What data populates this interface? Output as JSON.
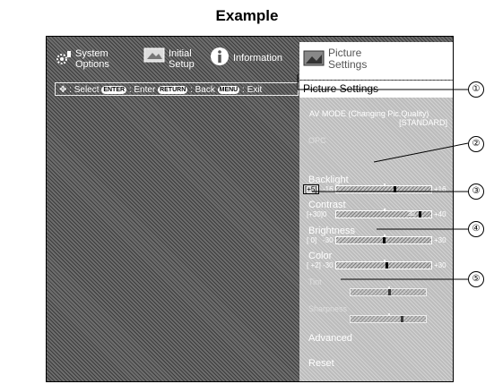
{
  "example_title": "Example",
  "top_menu": {
    "system_options": "System Options",
    "initial_setup": "Initial Setup",
    "information": "Information",
    "picture_settings": "Picture Settings",
    "menu": "Menu"
  },
  "guide": {
    "select": ": Select",
    "enter_key": "ENTER",
    "enter": ": Enter",
    "return_key": "RETURN",
    "back": ": Back",
    "menu_key": "MENU",
    "exit": ": Exit"
  },
  "panel": {
    "title": "Picture Settings",
    "av_mode_label": "AV MODE (Changing Pic.Quality)",
    "av_mode_value": "[STANDARD]",
    "opc": "OPC",
    "backlight": {
      "label": "Backlight",
      "value": "[+5]",
      "min": "-16",
      "max": "+16"
    },
    "contrast": {
      "label": "Contrast",
      "value": "[+30]",
      "min": "0",
      "max": "+40",
      "bar_num": "30"
    },
    "brightness": {
      "label": "Brightness",
      "value": "[ 0]",
      "min": "-30",
      "max": "+30"
    },
    "color": {
      "label": "Color",
      "value": "[ +2]",
      "min": "-30",
      "max": "+30"
    },
    "tint": "Tint",
    "sharpness": "Sharpness",
    "advanced": "Advanced",
    "reset": "Reset"
  },
  "callouts": [
    "①",
    "②",
    "③",
    "④",
    "⑤"
  ],
  "colors": {
    "screen_bg": "#6d6d6d",
    "panel_bg": "#bcbcbc",
    "highlight": "#ffffff"
  }
}
